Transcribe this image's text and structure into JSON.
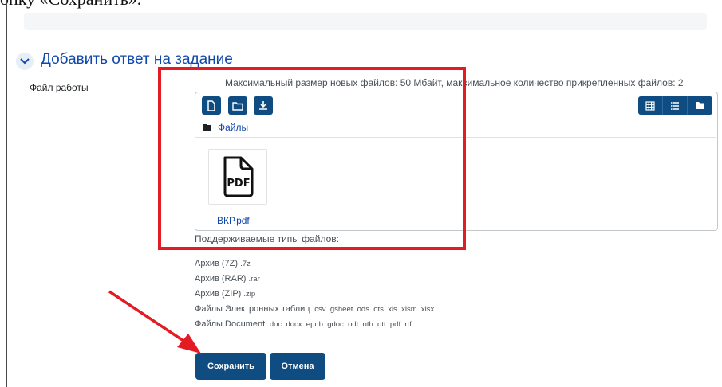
{
  "caption": {
    "text": "опку «Сохранить»."
  },
  "section": {
    "title": "Добавить ответ на задание"
  },
  "field": {
    "label": "Файл работы"
  },
  "filemanager": {
    "limits": "Максимальный размер новых файлов: 50 Мбайт, максимальное количество прикрепленных файлов: 2",
    "toolbar": {
      "add_file_icon": "file-icon",
      "create_folder_icon": "folder-icon",
      "download_icon": "download-icon",
      "view_icons": [
        "grid-view-icon",
        "list-view-icon",
        "tree-view-icon"
      ]
    },
    "path": "Файлы",
    "file": {
      "name": "ВКР.pdf",
      "type_label": "PDF"
    }
  },
  "accepted_types": {
    "label": "Поддерживаемые типы файлов:",
    "items": [
      {
        "name": "Архив (7Z)",
        "ext": ".7z"
      },
      {
        "name": "Архив (RAR)",
        "ext": ".rar"
      },
      {
        "name": "Архив (ZIP)",
        "ext": ".zip"
      },
      {
        "name": "Файлы Электронных таблиц",
        "ext": ".csv .gsheet .ods .ots .xls .xlsm .xlsx"
      },
      {
        "name": "Файлы Document",
        "ext": ".doc .docx .epub .gdoc .odt .oth .ott .pdf .rtf"
      }
    ]
  },
  "buttons": {
    "save": "Сохранить",
    "cancel": "Отмена"
  },
  "colors": {
    "accent": "#0f4c81",
    "link": "#0f47ad",
    "annotation": "#e31b23"
  }
}
